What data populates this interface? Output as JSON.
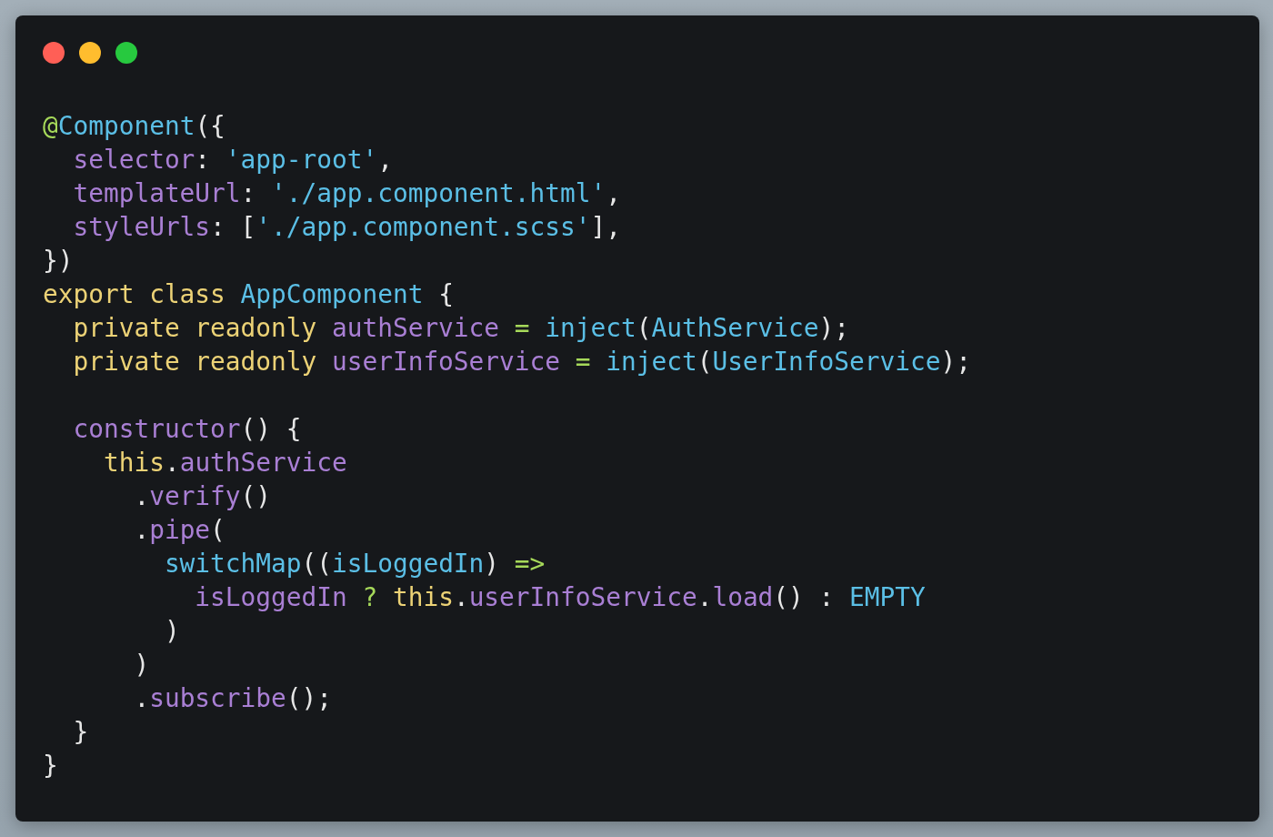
{
  "window": {
    "controls": [
      {
        "kind": "close"
      },
      {
        "kind": "minimize"
      },
      {
        "kind": "zoom"
      }
    ]
  },
  "code_blocks": [
    [
      [
        {
          "t": "@",
          "kind": "decorator"
        },
        {
          "t": "Component",
          "kind": "type"
        },
        {
          "t": "({",
          "kind": "plain"
        }
      ],
      [
        {
          "t": "  selector",
          "kind": "property"
        },
        {
          "t": ": ",
          "kind": "plain"
        },
        {
          "t": "'app-root'",
          "kind": "string"
        },
        {
          "t": ",",
          "kind": "plain"
        }
      ],
      [
        {
          "t": "  templateUrl",
          "kind": "property"
        },
        {
          "t": ": ",
          "kind": "plain"
        },
        {
          "t": "'./app.component.html'",
          "kind": "string"
        },
        {
          "t": ",",
          "kind": "plain"
        }
      ],
      [
        {
          "t": "  styleUrls",
          "kind": "property"
        },
        {
          "t": ": [",
          "kind": "plain"
        },
        {
          "t": "'./app.component.scss'",
          "kind": "string"
        },
        {
          "t": "],",
          "kind": "plain"
        }
      ],
      [
        {
          "t": "})",
          "kind": "plain"
        }
      ],
      [
        {
          "t": "export class ",
          "kind": "keyword"
        },
        {
          "t": "AppComponent",
          "kind": "type"
        },
        {
          "t": " {",
          "kind": "plain"
        }
      ],
      [
        {
          "t": "  private readonly ",
          "kind": "keyword"
        },
        {
          "t": "authService",
          "kind": "property"
        },
        {
          "t": " = ",
          "kind": "operator"
        },
        {
          "t": "inject",
          "kind": "type"
        },
        {
          "t": "(",
          "kind": "plain"
        },
        {
          "t": "AuthService",
          "kind": "type"
        },
        {
          "t": ");",
          "kind": "plain"
        }
      ],
      [
        {
          "t": "  private readonly ",
          "kind": "keyword"
        },
        {
          "t": "userInfoService",
          "kind": "property"
        },
        {
          "t": " = ",
          "kind": "operator"
        },
        {
          "t": "inject",
          "kind": "type"
        },
        {
          "t": "(",
          "kind": "plain"
        },
        {
          "t": "UserInfoService",
          "kind": "type"
        },
        {
          "t": ");",
          "kind": "plain"
        }
      ]
    ],
    [
      [
        {
          "t": "  constructor",
          "kind": "property"
        },
        {
          "t": "() {",
          "kind": "plain"
        }
      ],
      [
        {
          "t": "    this",
          "kind": "keyword"
        },
        {
          "t": ".",
          "kind": "plain"
        },
        {
          "t": "authService",
          "kind": "property"
        }
      ],
      [
        {
          "t": "      .",
          "kind": "plain"
        },
        {
          "t": "verify",
          "kind": "property"
        },
        {
          "t": "()",
          "kind": "plain"
        }
      ],
      [
        {
          "t": "      .",
          "kind": "plain"
        },
        {
          "t": "pipe",
          "kind": "property"
        },
        {
          "t": "(",
          "kind": "plain"
        }
      ],
      [
        {
          "t": "        switchMap",
          "kind": "type"
        },
        {
          "t": "((",
          "kind": "plain"
        },
        {
          "t": "isLoggedIn",
          "kind": "type"
        },
        {
          "t": ") ",
          "kind": "plain"
        },
        {
          "t": "=>",
          "kind": "operator"
        }
      ],
      [
        {
          "t": "          isLoggedIn",
          "kind": "property"
        },
        {
          "t": " ? ",
          "kind": "operator"
        },
        {
          "t": "this",
          "kind": "keyword"
        },
        {
          "t": ".",
          "kind": "plain"
        },
        {
          "t": "userInfoService",
          "kind": "property"
        },
        {
          "t": ".",
          "kind": "plain"
        },
        {
          "t": "load",
          "kind": "property"
        },
        {
          "t": "() : ",
          "kind": "plain"
        },
        {
          "t": "EMPTY",
          "kind": "type"
        }
      ],
      [
        {
          "t": "        )",
          "kind": "plain"
        }
      ],
      [
        {
          "t": "      )",
          "kind": "plain"
        }
      ],
      [
        {
          "t": "      .",
          "kind": "plain"
        },
        {
          "t": "subscribe",
          "kind": "property"
        },
        {
          "t": "();",
          "kind": "plain"
        }
      ],
      [
        {
          "t": "  }",
          "kind": "plain"
        }
      ],
      [
        {
          "t": "}",
          "kind": "plain"
        }
      ]
    ]
  ]
}
